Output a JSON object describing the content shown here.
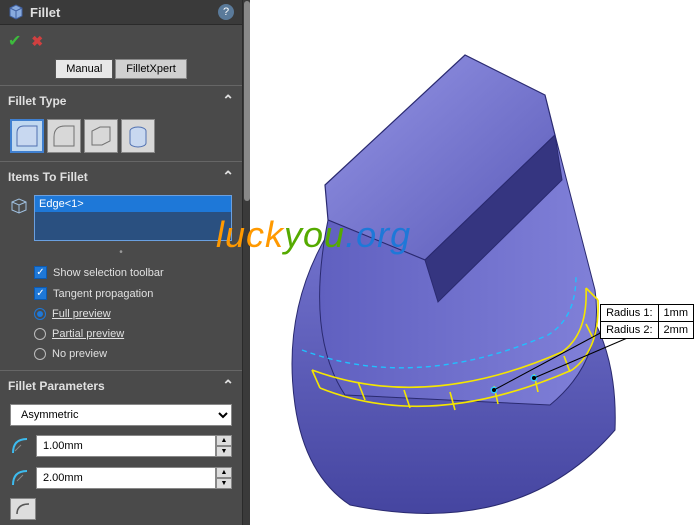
{
  "header": {
    "title": "Fillet"
  },
  "tabs": {
    "manual": "Manual",
    "xpert": "FilletXpert"
  },
  "sections": {
    "type": {
      "title": "Fillet Type"
    },
    "items": {
      "title": "Items To Fillet",
      "selection": "Edge<1>",
      "show_toolbar": "Show selection toolbar",
      "tangent": "Tangent propagation",
      "full": "Full preview",
      "partial": "Partial preview",
      "none": "No preview"
    },
    "params": {
      "title": "Fillet Parameters",
      "mode": "Asymmetric",
      "r1": "1.00mm",
      "r2": "2.00mm"
    }
  },
  "callout": {
    "r1label": "Radius 1:",
    "r1val": "1mm",
    "r2label": "Radius 2:",
    "r2val": "2mm"
  },
  "watermark": {
    "a": "luck",
    "b": "you",
    "c": ".org"
  }
}
